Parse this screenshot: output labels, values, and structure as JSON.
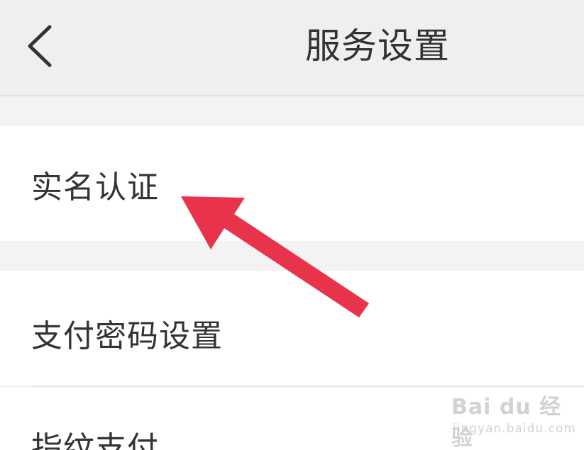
{
  "header": {
    "title": "服务设置",
    "back_icon": "chevron-left-icon"
  },
  "settings": {
    "items": [
      {
        "label": "实名认证"
      },
      {
        "label": "支付密码设置"
      },
      {
        "label": "指纹支付"
      }
    ]
  },
  "annotation": {
    "arrow_color": "#e8334a",
    "arrow_icon": "red-arrow-pointer"
  },
  "watermark": {
    "logo": "Bai du 经验",
    "url": "jingyan.baidu.com"
  },
  "colors": {
    "background": "#efefef",
    "row_background": "#ffffff",
    "text": "#333333"
  }
}
